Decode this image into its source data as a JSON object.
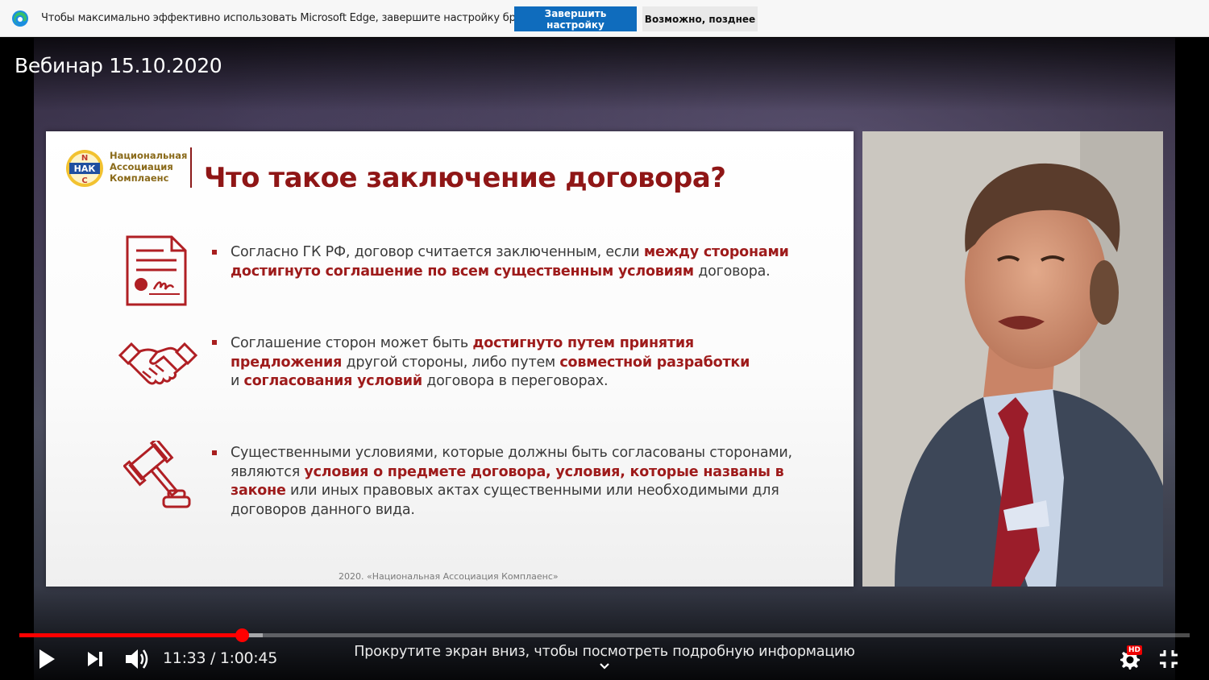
{
  "infobar": {
    "message": "Чтобы максимально эффективно использовать Microsoft Edge, завершите настройку браузера.",
    "primary_button": "Завершить настройку",
    "secondary_button": "Возможно, позднее"
  },
  "video": {
    "title": "Вебинар 15.10.2020"
  },
  "slide": {
    "logo_letters": {
      "top": "N",
      "middle": "НАК",
      "bottom": "C"
    },
    "logo_lines": [
      "Национальная",
      "Ассоциация",
      "Комплаенс"
    ],
    "title": "Что такое заключение договора?",
    "bullets": [
      {
        "icon": "contract-document-icon",
        "parts": [
          {
            "t": "Согласно ГК РФ, договор считается заключенным, если ",
            "b": false
          },
          {
            "t": "между сторонами достигнуто соглашение по всем существенным условиям",
            "b": true
          },
          {
            "t": " договора.",
            "b": false
          }
        ]
      },
      {
        "icon": "handshake-icon",
        "parts": [
          {
            "t": "Соглашение сторон может быть ",
            "b": false
          },
          {
            "t": "достигнуто путем принятия предложения",
            "b": true
          },
          {
            "t": " другой стороны, либо путем ",
            "b": false
          },
          {
            "t": "совместной разработки",
            "b": true
          },
          {
            "t": " и ",
            "b": false
          },
          {
            "t": "согласования условий",
            "b": true
          },
          {
            "t": " договора в переговорах.",
            "b": false
          }
        ]
      },
      {
        "icon": "gavel-icon",
        "parts": [
          {
            "t": "Существенными условиями, которые должны быть согласованы сторонами, являются ",
            "b": false
          },
          {
            "t": "условия о предмете договора, условия, которые названы в законе",
            "b": true
          },
          {
            "t": " или иных правовых актах существенными или необходимыми для договоров данного вида.",
            "b": false
          }
        ]
      }
    ],
    "footer": "2020. «Национальная Ассоциация Комплаенс»"
  },
  "controls": {
    "current_time": "11:33",
    "duration": "1:00:45",
    "time_text": "11:33 / 1:00:45",
    "played_fraction": 0.19,
    "buffered_fraction": 0.208,
    "scroll_hint": "Прокрутите экран вниз, чтобы посмотреть подробную информацию",
    "quality_badge": "HD",
    "colors": {
      "played": "#ff0000",
      "accent_button": "#0f6cbd",
      "slide_accent": "#9e1b1b"
    }
  }
}
